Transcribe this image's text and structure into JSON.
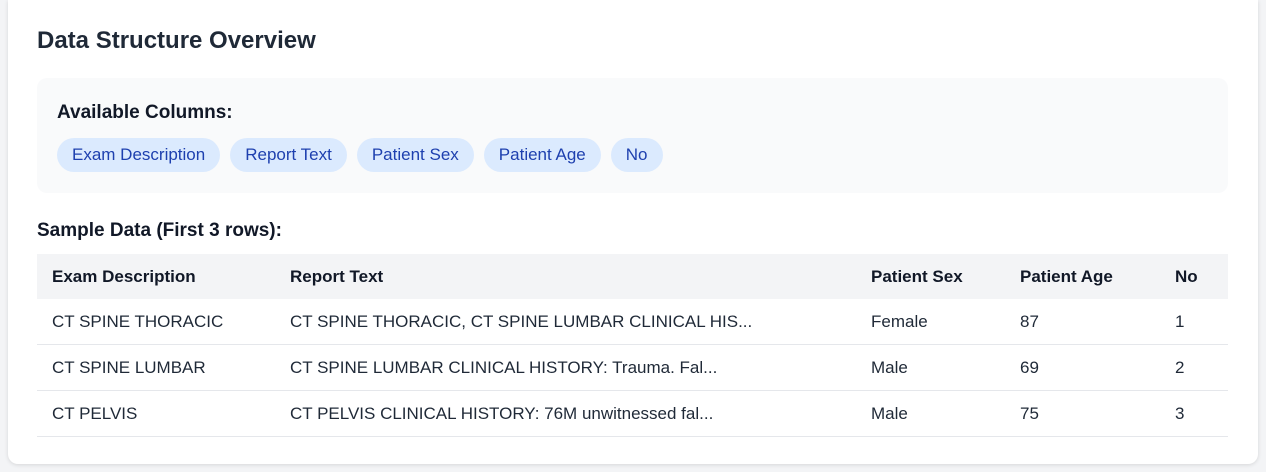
{
  "title": "Data Structure Overview",
  "columns_section": {
    "heading": "Available Columns:",
    "chips": [
      "Exam Description",
      "Report Text",
      "Patient Sex",
      "Patient Age",
      "No"
    ]
  },
  "sample_section": {
    "heading": "Sample Data (First 3 rows):",
    "headers": [
      "Exam Description",
      "Report Text",
      "Patient Sex",
      "Patient Age",
      "No"
    ],
    "rows": [
      [
        "CT SPINE THORACIC",
        "CT SPINE THORACIC, CT SPINE LUMBAR CLINICAL HIS...",
        "Female",
        "87",
        "1"
      ],
      [
        "CT SPINE LUMBAR",
        "CT SPINE LUMBAR CLINICAL HISTORY: Trauma. Fal...",
        "Male",
        "69",
        "2"
      ],
      [
        "CT PELVIS",
        "CT PELVIS CLINICAL HISTORY: 76M unwitnessed fal...",
        "Male",
        "75",
        "3"
      ]
    ]
  }
}
